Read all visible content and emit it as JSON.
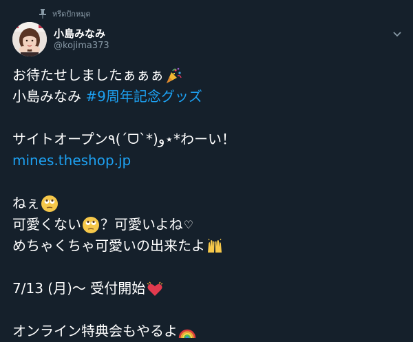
{
  "pinned": {
    "label": "หรีดปักหมุด",
    "icon": "pin-icon"
  },
  "author": {
    "name": "小島みなみ",
    "handle": "@kojima373",
    "avatar": "avatar-photo"
  },
  "menu": {
    "icon": "chevron-down-icon"
  },
  "tweet": {
    "line1": {
      "text": "お待たせしましたぁぁぁ",
      "emoji": "party-popper-icon"
    },
    "line2": {
      "text": "小島みなみ ",
      "hashtag": "#9周年記念グッズ"
    },
    "line3": {
      "text": "サイトオープン٩(ˊᗜˋ*)و⋆*わーい！"
    },
    "line4": {
      "link": "mines.theshop.jp"
    },
    "line5": {
      "text": "ねぇ",
      "emoji": "face-with-rolling-eyes-icon"
    },
    "line6": {
      "text_before": "可愛くない",
      "emoji": "face-with-rolling-eyes-icon",
      "text_after": "？可愛いよね",
      "heart": "♡"
    },
    "line7": {
      "text": "めちゃくちゃ可愛いの出来たよ",
      "emoji": "raising-hands-icon"
    },
    "line8": {
      "text": "7/13 (月)〜 受付開始",
      "emoji": "beating-heart-icon"
    },
    "line9": {
      "text": "オンライン特典会もやるよ",
      "emoji": "rainbow-icon"
    }
  },
  "colors": {
    "background": "#15202b",
    "text": "#ffffff",
    "secondary": "#8899a6",
    "link": "#1da1f2"
  }
}
